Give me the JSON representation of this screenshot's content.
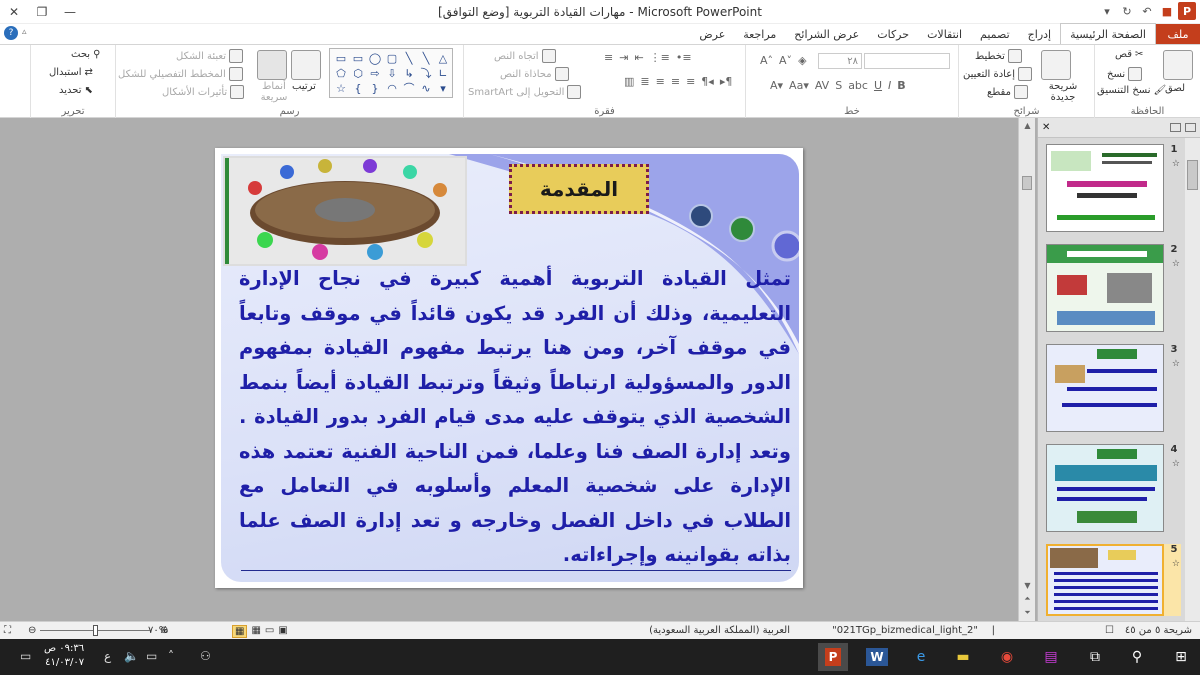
{
  "window": {
    "title": "مهارات القيادة التربوية [وضع التوافق] - Microsoft PowerPoint",
    "controls": [
      "✕",
      "❐",
      "—"
    ]
  },
  "tabs": {
    "file": "ملف",
    "items": [
      "الصفحة الرئيسية",
      "إدراج",
      "تصميم",
      "انتقالات",
      "حركات",
      "عرض الشرائح",
      "مراجعة",
      "عرض"
    ]
  },
  "ribbon": {
    "clipboard": {
      "label": "الحافظة",
      "paste": "لصق",
      "cut": "قص",
      "copy": "نسخ",
      "format_painter": "نسخ التنسيق"
    },
    "slides": {
      "label": "شرائح",
      "new_slide": "شريحة جديدة",
      "layout": "تخطيط",
      "reset": "إعادة التعيين",
      "section": "مقطع"
    },
    "font": {
      "label": "خط",
      "size": "٢٨"
    },
    "paragraph": {
      "label": "فقرة",
      "text_direction": "اتجاه النص",
      "align_text": "محاذاة النص",
      "smartart": "التحويل إلى SmartArt"
    },
    "drawing": {
      "label": "رسم",
      "arrange": "ترتيب",
      "quick_styles": "أنماط سريعة",
      "shape_fill": "تعبئة الشكل",
      "shape_outline": "المخطط التفصيلي للشكل",
      "shape_effects": "تأثيرات الأشكال"
    },
    "editing": {
      "label": "تحرير",
      "find": "بحث",
      "replace": "استبدال",
      "select": "تحديد"
    }
  },
  "slide": {
    "title": "المقدمة",
    "body": "تمثل القيادة التربوية أهمية كبيرة في نجاح الإدارة التعليمية، وذلك أن الفرد قد يكون قائداً في موقف وتابعاً في موقف آخر، ومن هنا يرتبط مفهوم القيادة بمفهوم الدور والمسؤولية ارتباطاً وثيقاً وترتبط القيادة أيضاً بنمط الشخصية الذي يتوقف عليه مدى قيام الفرد بدور القيادة . وتعد إدارة الصف فنا وعلما، فمن الناحية الفنية تعتمد هذه الإدارة على شخصية المعلم وأسلوبه في التعامل مع الطلاب في داخل الفصل وخارجه و تعد إدارة الصف علما بذاته بقوانينه وإجراءاته."
  },
  "thumbnails": [
    {
      "num": "1"
    },
    {
      "num": "2"
    },
    {
      "num": "3"
    },
    {
      "num": "4"
    },
    {
      "num": "5"
    }
  ],
  "status": {
    "slide_of": "شريحة ٥ من ٤٥",
    "theme": "\"2_021TGp_bizmedical_light\"",
    "language": "العربية (المملكة العربية السعودية)",
    "zoom": "%٧٠"
  },
  "taskbar": {
    "time": "٠٩:٣٦ ص",
    "date": "٤١/٠٣/٠٧",
    "lang": "ع"
  },
  "colors": {
    "accent": "#c43e1c",
    "slide_text": "#1f1fa8",
    "title_box": "#e8cc5a"
  }
}
